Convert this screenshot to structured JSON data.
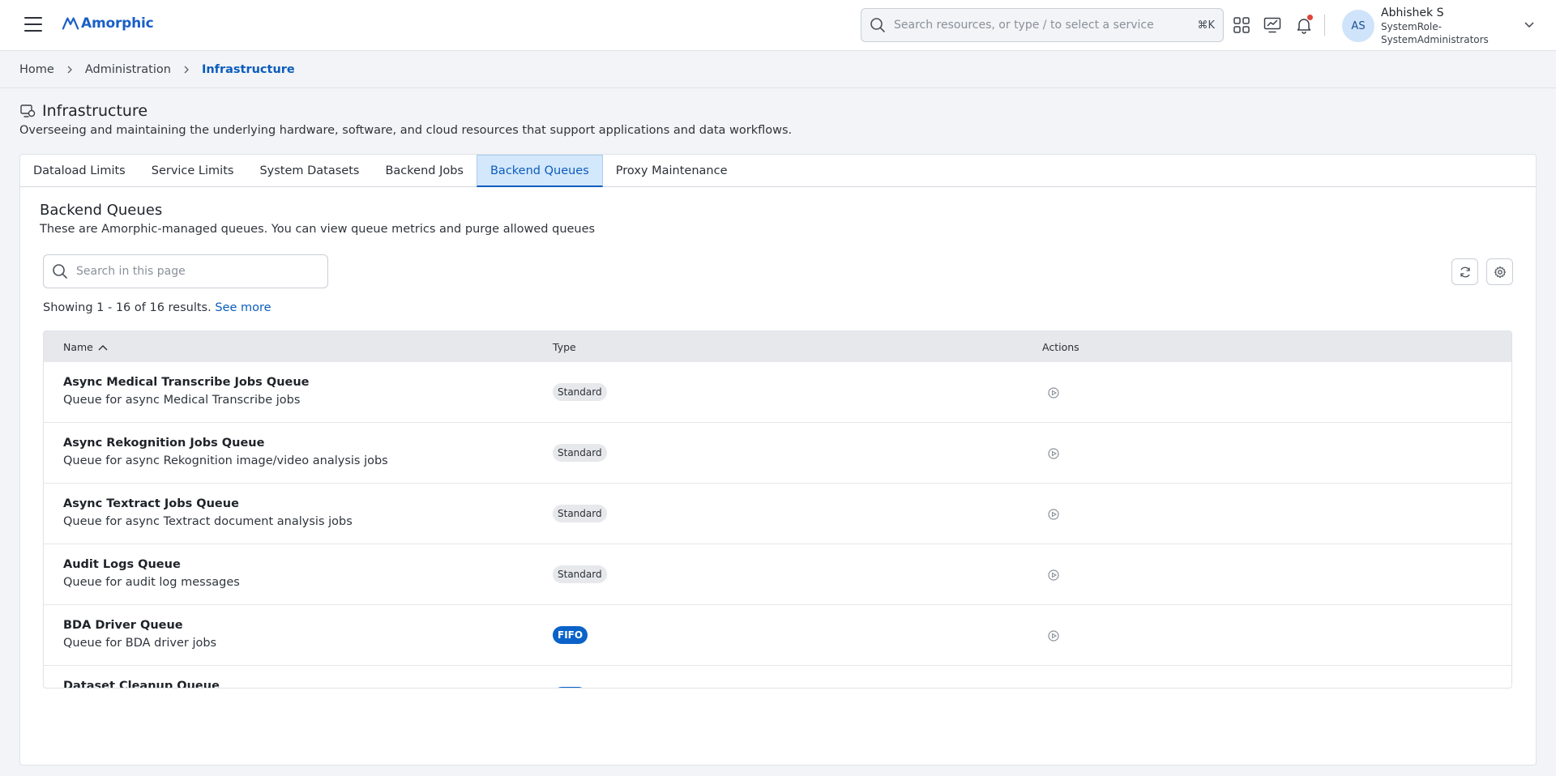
{
  "app": {
    "brand": "Amorphic"
  },
  "topbar": {
    "search_placeholder": "Search resources, or type / to select a service",
    "shortcut": "⌘K",
    "user": {
      "initials": "AS",
      "name": "Abhishek S",
      "role": "SystemRole-SystemAdministrators"
    }
  },
  "breadcrumb": {
    "home": "Home",
    "admin": "Administration",
    "current": "Infrastructure"
  },
  "page": {
    "title": "Infrastructure",
    "description": "Overseeing and maintaining the underlying hardware, software, and cloud resources that support applications and data workflows."
  },
  "tabs": [
    "Dataload Limits",
    "Service Limits",
    "System Datasets",
    "Backend Jobs",
    "Backend Queues",
    "Proxy Maintenance"
  ],
  "section": {
    "title": "Backend Queues",
    "description": "These are Amorphic-managed queues. You can view queue metrics and purge allowed queues",
    "search_placeholder": "Search in this page",
    "results_text": "Showing 1 - 16 of 16 results.",
    "see_more": "See more"
  },
  "table": {
    "columns": {
      "name": "Name",
      "type": "Type",
      "actions": "Actions"
    },
    "rows": [
      {
        "name": "Async Medical Transcribe Jobs Queue",
        "desc": "Queue for async Medical Transcribe jobs",
        "type": "Standard"
      },
      {
        "name": "Async Rekognition Jobs Queue",
        "desc": "Queue for async Rekognition image/video analysis jobs",
        "type": "Standard"
      },
      {
        "name": "Async Textract Jobs Queue",
        "desc": "Queue for async Textract document analysis jobs",
        "type": "Standard"
      },
      {
        "name": "Audit Logs Queue",
        "desc": "Queue for audit log messages",
        "type": "Standard"
      },
      {
        "name": "BDA Driver Queue",
        "desc": "Queue for BDA driver jobs",
        "type": "FIFO"
      },
      {
        "name": "Dataset Cleanup Queue",
        "desc": "",
        "type": "FIFO"
      }
    ]
  },
  "colors": {
    "accent": "#0b5cbd",
    "fifo_badge": "#0b63c9",
    "active_tab_bg": "#d4e8fb",
    "notification": "#e0443a"
  }
}
